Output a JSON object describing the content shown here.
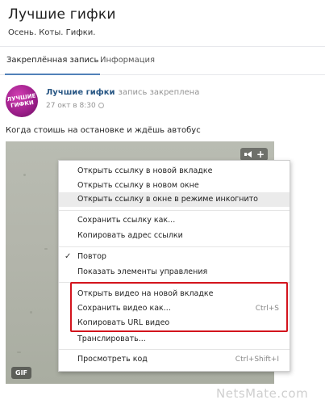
{
  "group": {
    "title": "Лучшие гифки",
    "description": "Осень. Коты. Гифки."
  },
  "tabs": [
    {
      "label": "Закреплённая запись",
      "active": true
    },
    {
      "label": "Информация",
      "active": false
    }
  ],
  "post": {
    "avatar_text_line1": "ЛУЧШИЕ",
    "avatar_text_line2": "ГИФКИ",
    "author": "Лучшие гифки",
    "pin_note": "запись закреплена",
    "date": "27 окт в 8:30",
    "text": "Когда стоишь на остановке и ждёшь автобус",
    "gif_badge": "GIF"
  },
  "context_menu": {
    "items": [
      {
        "label": "Открыть ссылку в новой вкладке"
      },
      {
        "label": "Открыть ссылку в новом окне"
      },
      {
        "label": "Открыть ссылку в окне в режиме инкогнито",
        "highlighted": true
      },
      {
        "label": "Сохранить ссылку как..."
      },
      {
        "label": "Копировать адрес ссылки"
      },
      {
        "label": "Повтор",
        "checked": true
      },
      {
        "label": "Показать элементы управления"
      },
      {
        "label": "Открыть видео на новой вкладке"
      },
      {
        "label": "Сохранить видео как...",
        "shortcut": "Ctrl+S"
      },
      {
        "label": "Копировать URL видео"
      },
      {
        "label": "Транслировать..."
      },
      {
        "label": "Просмотреть код",
        "shortcut": "Ctrl+Shift+I"
      }
    ]
  },
  "watermark": "NetsMate.com",
  "colors": {
    "link": "#2a5885",
    "highlight_frame": "#d3141d",
    "tab_underline": "#5181b8",
    "avatar": "#9a1d88"
  }
}
